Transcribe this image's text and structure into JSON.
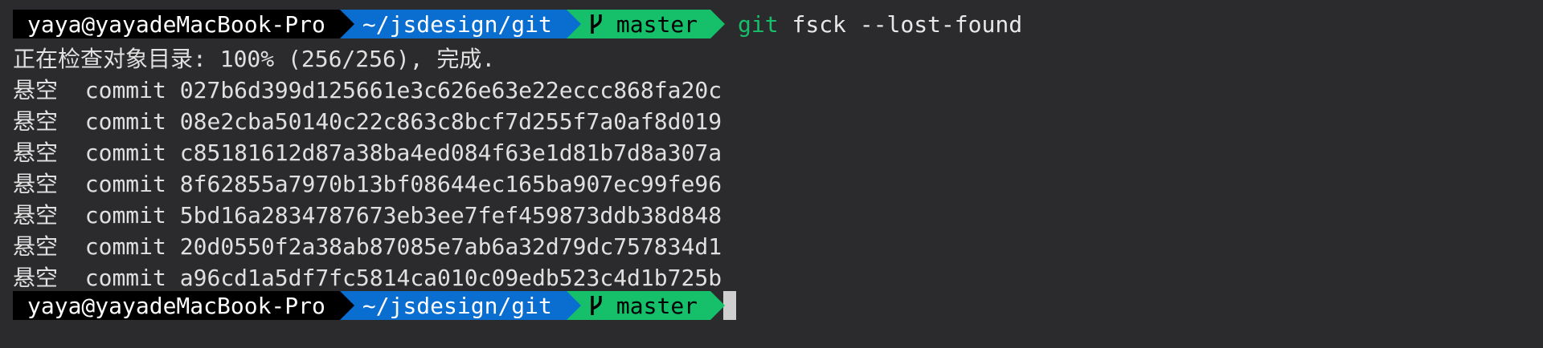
{
  "prompt": {
    "user_host": "yaya@yayadeMacBook-Pro",
    "directory": "~/jsdesign/git",
    "branch": "master"
  },
  "command": {
    "program": "git",
    "args": "fsck --lost-found"
  },
  "output": {
    "progress_line": "正在检查对象目录: 100% (256/256), 完成.",
    "dangling_label": "悬空",
    "commits": [
      {
        "type": "commit",
        "hash": "027b6d399d125661e3c626e63e22eccc868fa20c"
      },
      {
        "type": "commit",
        "hash": "08e2cba50140c22c863c8bcf7d255f7a0af8d019"
      },
      {
        "type": "commit",
        "hash": "c85181612d87a38ba4ed084f63e1d81b7d8a307a"
      },
      {
        "type": "commit",
        "hash": "8f62855a7970b13bf08644ec165ba907ec99fe96"
      },
      {
        "type": "commit",
        "hash": "5bd16a2834787673eb3ee7fef459873ddb38d848"
      },
      {
        "type": "commit",
        "hash": "20d0550f2a38ab87085e7ab6a32d79dc757834d1"
      },
      {
        "type": "commit",
        "hash": "a96cd1a5df7fc5814ca010c09edb523c4d1b725b"
      }
    ]
  },
  "colors": {
    "background": "#2b2b2d",
    "user_segment": "#000000",
    "dir_segment": "#0a6ed1",
    "branch_segment": "#16c06a",
    "git_keyword": "#16c06a"
  },
  "icons": {
    "branch": "git-branch-icon"
  }
}
